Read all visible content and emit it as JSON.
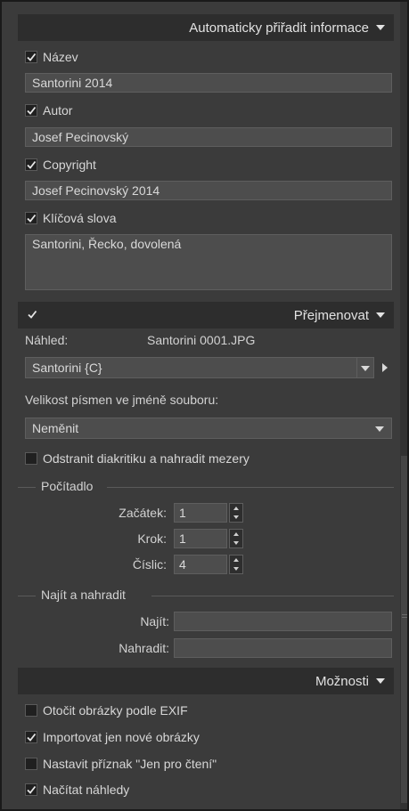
{
  "sections": {
    "auto_info": {
      "title": "Automaticky přiřadit informace",
      "name_label": "Název",
      "name_value": "Santorini 2014",
      "author_label": "Autor",
      "author_value": "Josef Pecinovský",
      "copyright_label": "Copyright",
      "copyright_value": "Josef Pecinovský 2014",
      "keywords_label": "Klíčová slova",
      "keywords_value": "Santorini, Řecko, dovolená"
    },
    "rename": {
      "title": "Přejmenovat",
      "preview_label": "Náhled:",
      "preview_value": "Santorini 0001.JPG",
      "template_value": "Santorini {C}",
      "case_label": "Velikost písmen ve jméně souboru:",
      "case_value": "Neměnit",
      "strip_label": "Odstranit diakritiku a nahradit mezery",
      "counter_title": "Počítadlo",
      "start_label": "Začátek:",
      "start_value": "1",
      "step_label": "Krok:",
      "step_value": "1",
      "digits_label": "Číslic:",
      "digits_value": "4",
      "findreplace_title": "Najít a nahradit",
      "find_label": "Najít:",
      "find_value": "",
      "replace_label": "Nahradit:",
      "replace_value": ""
    },
    "options": {
      "title": "Možnosti",
      "rotate_label": "Otočit obrázky podle EXIF",
      "import_new_label": "Importovat jen nové obrázky",
      "readonly_label": "Nastavit příznak \"Jen pro čtení\"",
      "load_previews_label": "Načítat náhledy"
    }
  },
  "checked": {
    "name": true,
    "author": true,
    "copyright": true,
    "keywords": true,
    "rename": true,
    "strip": false,
    "rotate": false,
    "import_new": true,
    "readonly": false,
    "load_previews": true
  },
  "colors": {
    "panel": "#3b3b3b",
    "header": "#2d2d2d",
    "field": "#4d4d4d",
    "text": "#d7d7d7"
  }
}
